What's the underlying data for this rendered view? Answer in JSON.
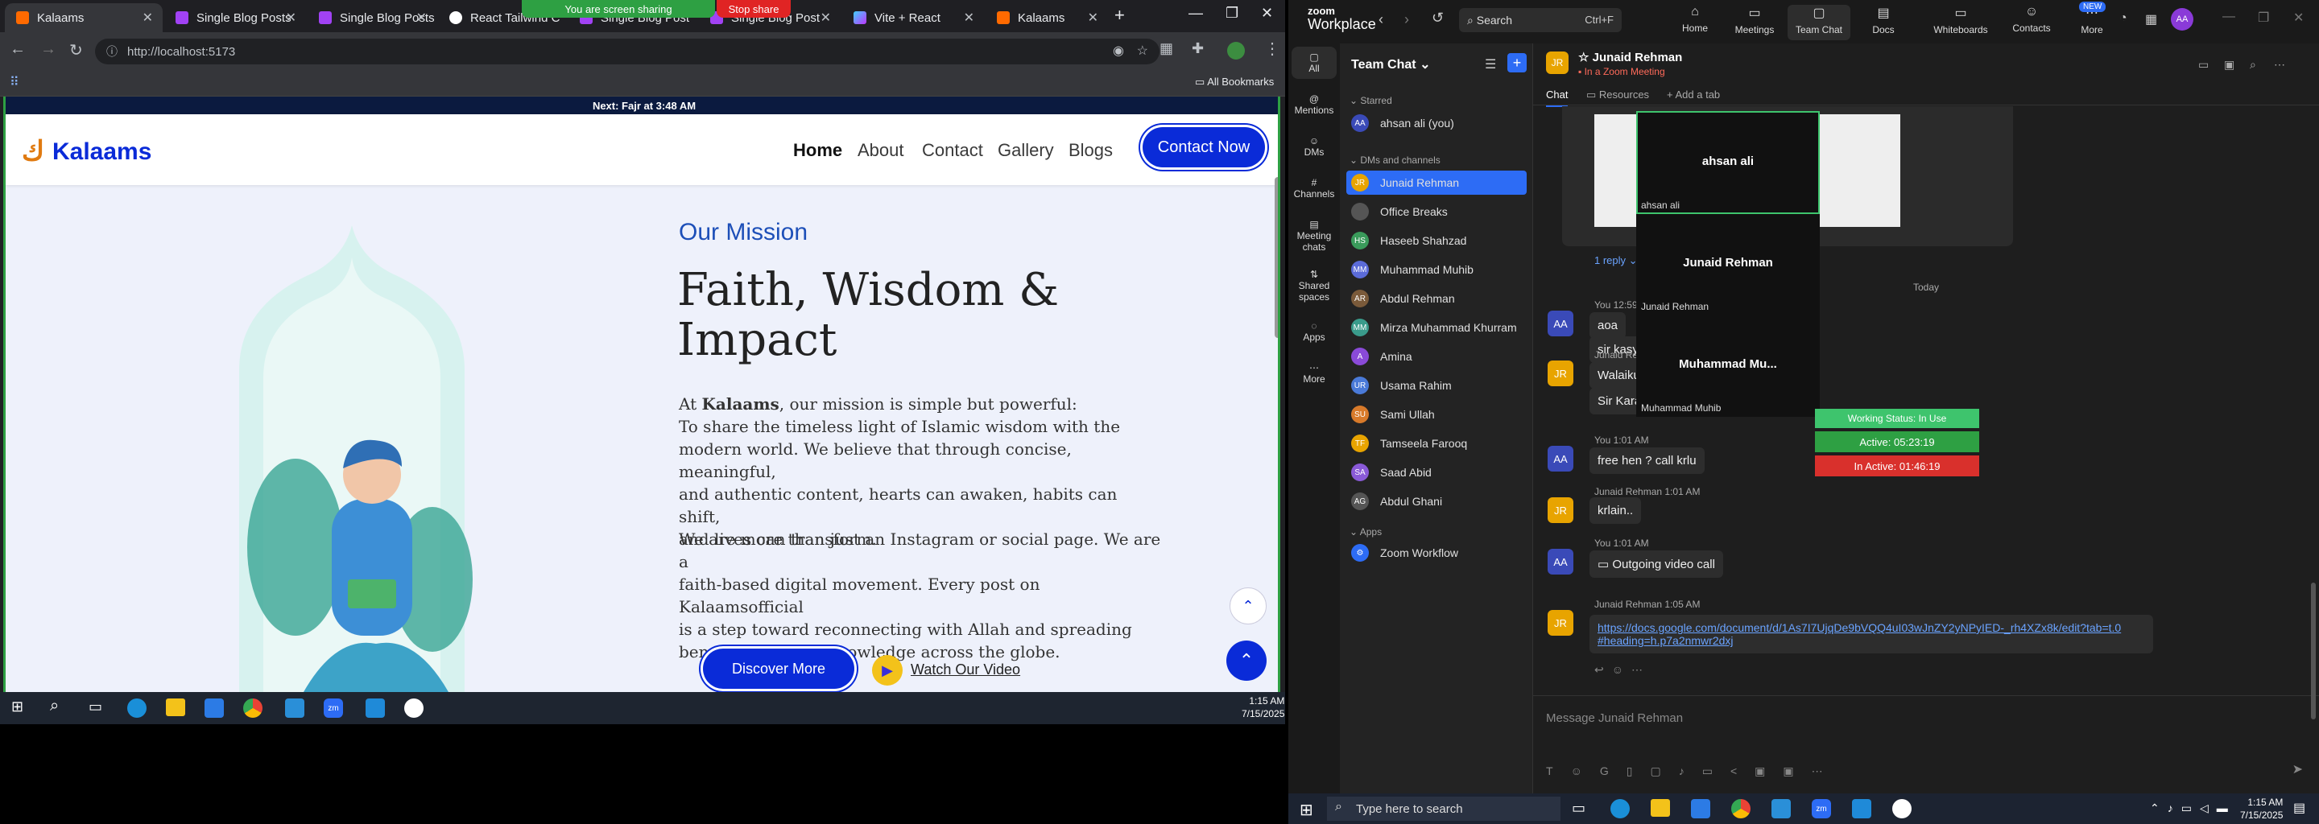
{
  "browser": {
    "tabs": [
      {
        "title": "Kalaams",
        "active": true
      },
      {
        "title": "Single Blog Posts",
        "active": false
      },
      {
        "title": "Single Blog Posts",
        "active": false
      },
      {
        "title": "React Tailwind C",
        "active": false
      },
      {
        "title": "Single Blog Post",
        "active": false
      },
      {
        "title": "Single Blog Post",
        "active": false
      },
      {
        "title": "Vite + React",
        "active": false
      },
      {
        "title": "Kalaams",
        "active": false
      }
    ],
    "share_banner": "You are screen sharing",
    "stop_share": "Stop share",
    "url": "http://localhost:5173",
    "all_bookmarks": "All Bookmarks"
  },
  "site": {
    "top_note": "Next: Fajr at 3:48 AM",
    "logo": "Kalaams",
    "nav": [
      "Home",
      "About",
      "Contact",
      "Gallery",
      "Blogs"
    ],
    "contact_button": "Contact Now",
    "mission_label": "Our Mission",
    "heading_line1": "Faith, Wisdom &",
    "heading_line2": "Impact",
    "para1_prefix": "At ",
    "para1_brand": "Kalaams",
    "para1_rest": ", our mission is simple but powerful:",
    "para1_lines": [
      "To share the timeless light of Islamic wisdom with the",
      "modern world. We believe that through concise, meaningful,",
      "and authentic content, hearts can awaken, habits can shift,",
      "and lives can transform."
    ],
    "para2_lines": [
      "We are more than just an Instagram or social page. We are a",
      "faith-based digital movement. Every post on Kalaamsofficial",
      "is a step toward reconnecting with Allah and spreading",
      "beneficial Islamic knowledge across the globe."
    ],
    "discover_button": "Discover More",
    "watch_video": "Watch Our Video"
  },
  "left_taskbar": {
    "time": "1:15 AM",
    "date": "7/15/2025"
  },
  "zoom": {
    "brand_line1": "zoom",
    "brand_line2": "Workplace",
    "search": "Search",
    "search_shortcut": "Ctrl+F",
    "top_tabs": [
      "Home",
      "Meetings",
      "Team Chat",
      "Docs",
      "Whiteboards",
      "Contacts",
      "More"
    ],
    "new_badge": "NEW",
    "rail": [
      "All",
      "Mentions",
      "DMs",
      "Channels",
      "Meeting chats",
      "Shared spaces",
      "Apps",
      "More"
    ],
    "list_title": "Team Chat",
    "starred": "Starred",
    "me": "ahsan ali (you)",
    "dms_channels": "DMs and channels",
    "contacts": [
      {
        "name": "Junaid Rehman",
        "initials": "JR",
        "color": "#e8a400",
        "selected": true
      },
      {
        "name": "Office Breaks",
        "initials": "",
        "color": "#555",
        "selected": false
      },
      {
        "name": "Haseeb Shahzad",
        "initials": "HS",
        "color": "#3a9b5b",
        "selected": false
      },
      {
        "name": "Muhammad Muhib",
        "initials": "MM",
        "color": "#5b6bd8",
        "selected": false
      },
      {
        "name": "Abdul Rehman",
        "initials": "AR",
        "color": "#7a5a3a",
        "selected": false
      },
      {
        "name": "Mirza Muhammad Khurram",
        "initials": "MM",
        "color": "#3a9b8b",
        "selected": false
      },
      {
        "name": "Amina",
        "initials": "A",
        "color": "#8a4ad8",
        "selected": false
      },
      {
        "name": "Usama Rahim",
        "initials": "UR",
        "color": "#4a7ad8",
        "selected": false
      },
      {
        "name": "Sami Ullah",
        "initials": "SU",
        "color": "#d87a2a",
        "selected": false
      },
      {
        "name": "Tamseela Farooq",
        "initials": "TF",
        "color": "#e8a400",
        "selected": false
      },
      {
        "name": "Saad Abid",
        "initials": "SA",
        "color": "#8a5ad8",
        "selected": false
      },
      {
        "name": "Abdul Ghani",
        "initials": "AG",
        "color": "#555",
        "selected": false
      }
    ],
    "apps_section": "Apps",
    "zoom_workflow": "Zoom Workflow",
    "chat_header_name": "Junaid Rehman",
    "chat_header_status": "In a Zoom Meeting",
    "chat_tabs": [
      "Chat",
      "Resources",
      "Add a tab"
    ],
    "reply_link": "1 reply",
    "today": "Today",
    "messages": [
      {
        "who": "You",
        "time": "12:59 AM",
        "initials": "AA",
        "color": "#3a4ab8",
        "texts": [
          "aoa",
          "sir kasy hen ap"
        ]
      },
      {
        "who": "Junaid Rehman",
        "time": "1:01 AM",
        "initials": "JR",
        "color": "#e8a400",
        "texts": [
          "Walaikum Salam..",
          "Sir Karam hai Allah ka. Aap Sunao.."
        ]
      },
      {
        "who": "You",
        "time": "1:01 AM",
        "initials": "AA",
        "color": "#3a4ab8",
        "texts": [
          "free hen ? call krlu"
        ]
      },
      {
        "who": "Junaid Rehman",
        "time": "1:01 AM",
        "initials": "JR",
        "color": "#e8a400",
        "texts": [
          "krlain.."
        ]
      },
      {
        "who": "You",
        "time": "1:01 AM",
        "initials": "AA",
        "color": "#3a4ab8",
        "texts": [
          "Outgoing video call"
        ]
      },
      {
        "who": "Junaid Rehman",
        "time": "1:05 AM",
        "initials": "JR",
        "color": "#e8a400",
        "texts": [
          "https://docs.google.com/document/d/1As7I7UjqDe9bVQQ4uI03wJnZY2yNPyIED-_rh4XZx8k/edit?tab=t.0",
          "#heading=h.p7a2nmwr2dxj"
        ]
      }
    ],
    "composer_placeholder": "Message Junaid Rehman",
    "video_tiles": [
      "ahsan ali",
      "Junaid Rehman",
      "Muhammad  Mu..."
    ],
    "video_tile_labels": [
      "ahsan ali",
      "Junaid Rehman",
      "Muhammad Muhib"
    ],
    "status_working": "Working Status: In Use",
    "status_active": "Active: 05:23:19",
    "status_inactive": "In Active: 01:46:19"
  },
  "win_taskbar": {
    "search": "Type here to search",
    "time": "1:15 AM",
    "date": "7/15/2025"
  }
}
